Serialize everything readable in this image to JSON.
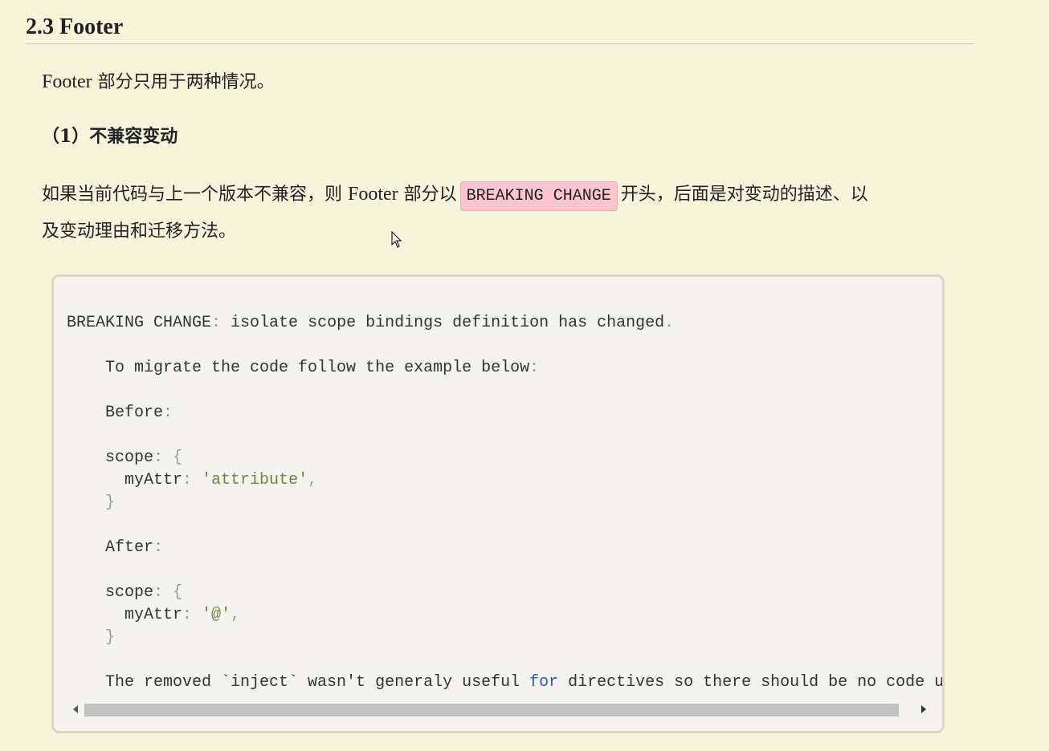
{
  "section": {
    "heading": "2.3 Footer",
    "intro_latin": "Footer",
    "intro_cjk": " 部分只用于两种情况。",
    "subheading": "（1）不兼容变动",
    "para_part1": "如果当前代码与上一个版本不兼容，则 ",
    "para_latin": "Footer",
    "para_part2": " 部分以",
    "inline_code": "BREAKING CHANGE",
    "para_part3": "开头，后面是对变动的描述、以",
    "para_line2": "及变动理由和迁移方法。"
  },
  "code": {
    "l1_a": "BREAKING CHANGE",
    "l1_b": ":",
    "l1_c": " isolate scope bindings definition has changed",
    "l1_d": ".",
    "l2_a": "    To migrate the code follow the example below",
    "l2_b": ":",
    "l3_a": "    Before",
    "l3_b": ":",
    "l4_a": "    scope",
    "l4_b": ": {",
    "l5_a": "      myAttr",
    "l5_b": ": ",
    "l5_c": "'attribute'",
    "l5_d": ",",
    "l6": "    }",
    "l7_a": "    After",
    "l7_b": ":",
    "l8_a": "    scope",
    "l8_b": ": {",
    "l9_a": "      myAttr",
    "l9_b": ": ",
    "l9_c": "'@'",
    "l9_d": ",",
    "l10": "    }",
    "l11_a": "    The removed `inject` wasn't generaly useful ",
    "l11_kw": "for",
    "l11_b": " directives so there should be no code using i"
  },
  "icons": {
    "scroll_left": "arrow-left-icon",
    "scroll_right": "arrow-right-icon",
    "cursor": "mouse-pointer-icon"
  },
  "colors": {
    "background": "#f5f5dc",
    "inline_code_bg": "#fbc5cf",
    "code_bg": "#f4f3ef",
    "string": "#6a8a3a",
    "keyword": "#2a5db0"
  }
}
